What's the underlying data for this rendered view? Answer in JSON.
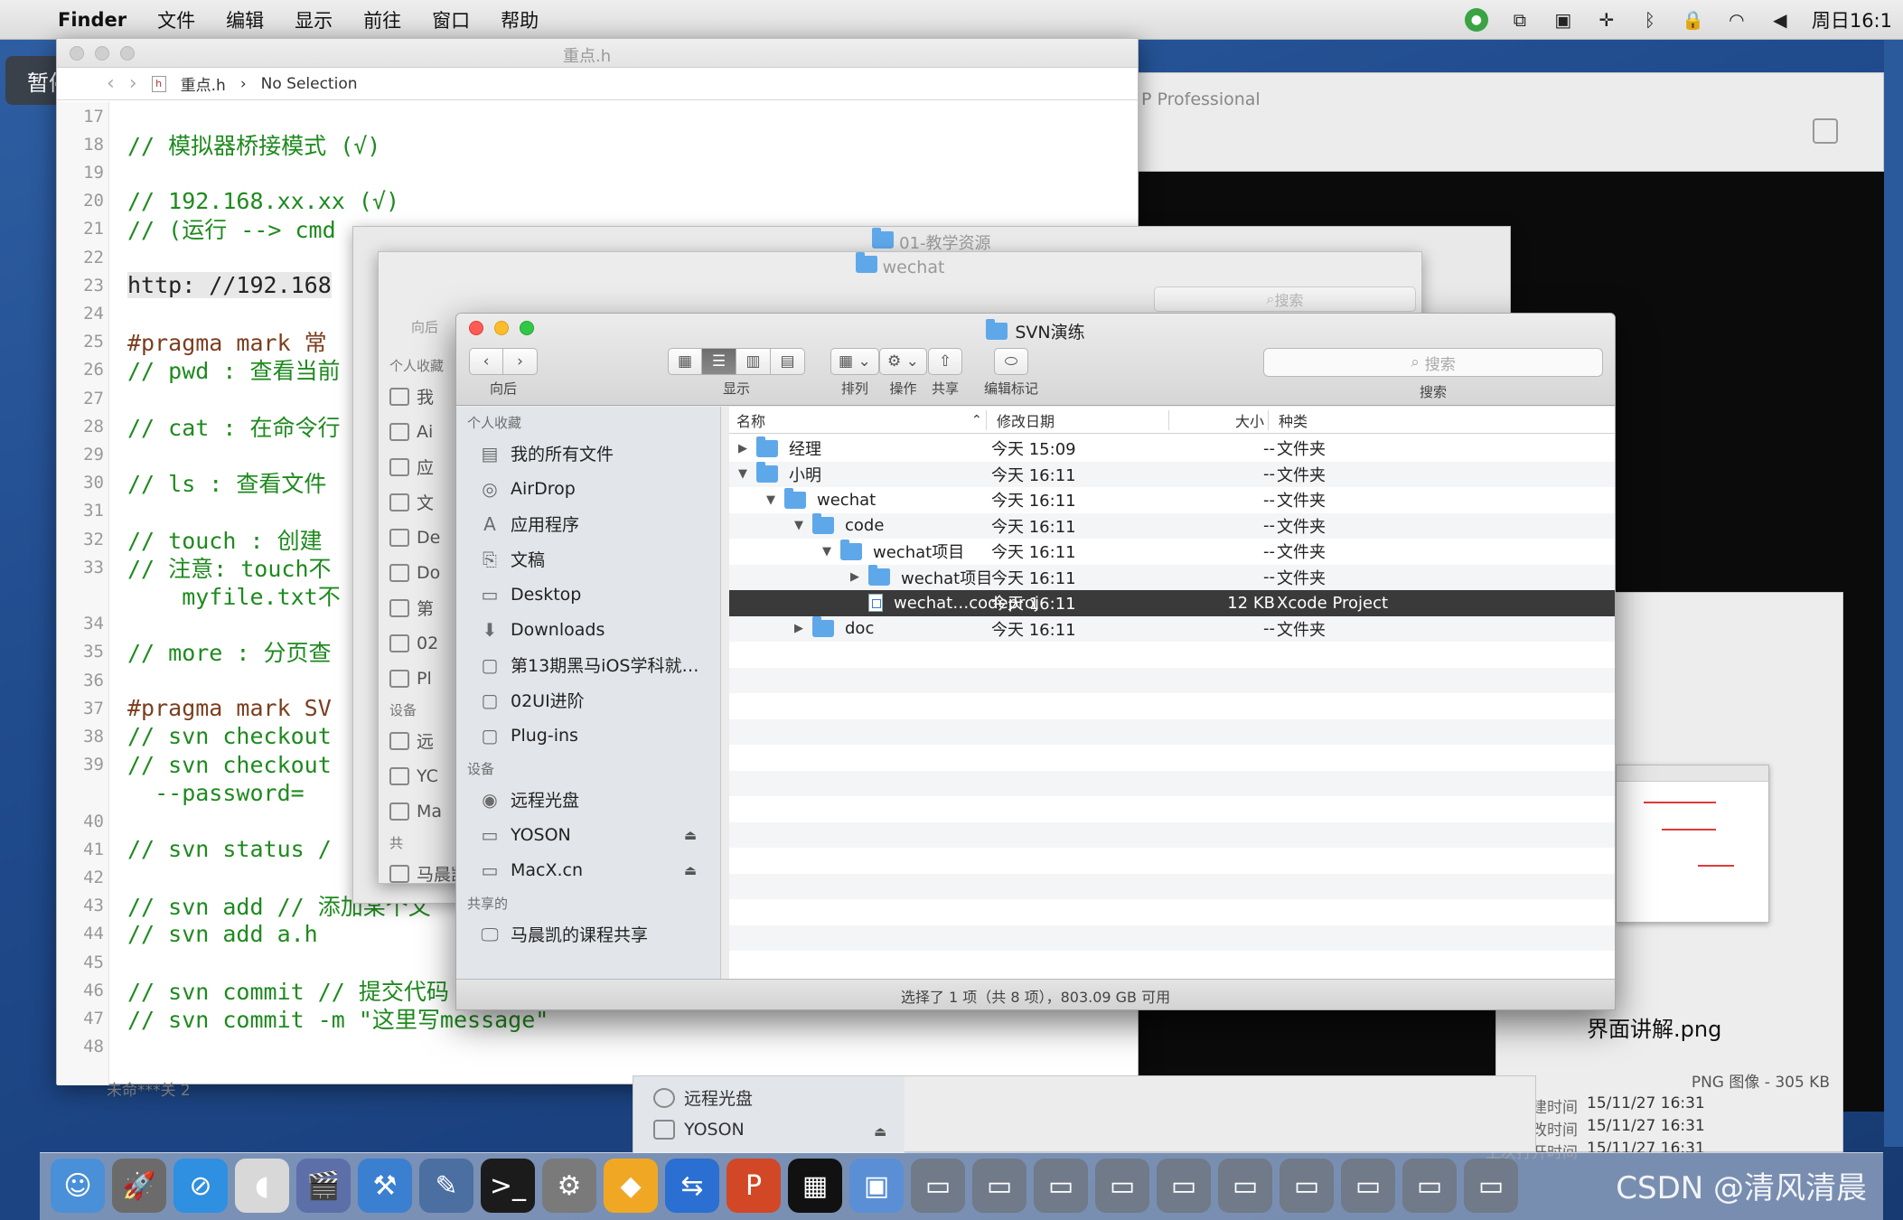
{
  "menubar": {
    "app_name": "Finder",
    "items": [
      "文件",
      "编辑",
      "显示",
      "前往",
      "窗口",
      "帮助"
    ],
    "clock": "周日16:1"
  },
  "pause_label": "暂停",
  "background": {
    "pro_window_title": "P Professional"
  },
  "xcode": {
    "title": "重点.h",
    "breadcrumb_file": "重点.h",
    "breadcrumb_sel": "No Selection",
    "lines": [
      {
        "n": "17",
        "t": "",
        "k": "c"
      },
      {
        "n": "18",
        "t": "// 模拟器桥接模式 (√)",
        "k": "c"
      },
      {
        "n": "19",
        "t": "",
        "k": "c"
      },
      {
        "n": "20",
        "t": "// 192.168.xx.xx (√)",
        "k": "c"
      },
      {
        "n": "21",
        "t": "// (运行 --> cmd",
        "k": "c"
      },
      {
        "n": "22",
        "t": "",
        "k": "c"
      },
      {
        "n": "23",
        "t": "http: //192.168",
        "k": "h"
      },
      {
        "n": "24",
        "t": "",
        "k": "c"
      },
      {
        "n": "25",
        "t": "#pragma mark 常",
        "k": "p"
      },
      {
        "n": "26",
        "t": "// pwd : 查看当前",
        "k": "c"
      },
      {
        "n": "27",
        "t": "",
        "k": "c"
      },
      {
        "n": "28",
        "t": "// cat : 在命令行",
        "k": "c"
      },
      {
        "n": "29",
        "t": "",
        "k": "c"
      },
      {
        "n": "30",
        "t": "// ls : 查看文件",
        "k": "c"
      },
      {
        "n": "31",
        "t": "",
        "k": "c"
      },
      {
        "n": "32",
        "t": "// touch : 创建",
        "k": "c"
      },
      {
        "n": "33",
        "t": "// 注意: touch不",
        "k": "c"
      },
      {
        "n": "",
        "t": "    myfile.txt不",
        "k": "c"
      },
      {
        "n": "34",
        "t": "",
        "k": "c"
      },
      {
        "n": "35",
        "t": "// more : 分页查",
        "k": "c"
      },
      {
        "n": "36",
        "t": "",
        "k": "c"
      },
      {
        "n": "37",
        "t": "#pragma mark SV",
        "k": "p"
      },
      {
        "n": "38",
        "t": "// svn checkout",
        "k": "c"
      },
      {
        "n": "39",
        "t": "// svn checkout",
        "k": "c"
      },
      {
        "n": "",
        "t": "  --password=",
        "k": "c"
      },
      {
        "n": "40",
        "t": "",
        "k": "c"
      },
      {
        "n": "41",
        "t": "// svn status /",
        "k": "c"
      },
      {
        "n": "42",
        "t": "",
        "k": "c"
      },
      {
        "n": "43",
        "t": "// svn add // 添加某个文",
        "k": "c"
      },
      {
        "n": "44",
        "t": "// svn add a.h",
        "k": "c"
      },
      {
        "n": "45",
        "t": "",
        "k": "c"
      },
      {
        "n": "46",
        "t": "// svn commit // 提交代码",
        "k": "c"
      },
      {
        "n": "47",
        "t": "// svn commit -m \"这里写message\"",
        "k": "c"
      },
      {
        "n": "48",
        "t": "",
        "k": "c"
      }
    ],
    "bottom_text": "未命***关 2"
  },
  "finder_back1": {
    "title": "01-教学资源"
  },
  "finder_back2": {
    "title": "wechat",
    "back_label": "向后",
    "search": "搜索",
    "head1": "个人收藏",
    "items": [
      "我",
      "Ai",
      "应",
      "文",
      "De",
      "Do",
      "第",
      "02",
      "Pl"
    ],
    "head2": "设备",
    "dev_items": [
      "远",
      "YC",
      "Ma"
    ],
    "head3": "共",
    "share_item": "马晨凯"
  },
  "finder": {
    "title": "SVN演练",
    "toolbar": {
      "back_label": "向后",
      "view_label": "显示",
      "arrange_label": "排列",
      "action_label": "操作",
      "share_label": "共享",
      "tags_label": "编辑标记",
      "search_placeholder": "搜索",
      "search_label": "搜索"
    },
    "sidebar": {
      "favorites_head": "个人收藏",
      "favorites": [
        {
          "label": "我的所有文件",
          "icon": "all-files-icon",
          "glyph": "▤"
        },
        {
          "label": "AirDrop",
          "icon": "airdrop-icon",
          "glyph": "◎"
        },
        {
          "label": "应用程序",
          "icon": "applications-icon",
          "glyph": "A"
        },
        {
          "label": "文稿",
          "icon": "documents-icon",
          "glyph": "⎘"
        },
        {
          "label": "Desktop",
          "icon": "desktop-icon",
          "glyph": "▭"
        },
        {
          "label": "Downloads",
          "icon": "downloads-icon",
          "glyph": "⬇"
        },
        {
          "label": "第13期黑马iOS学科就…",
          "icon": "folder-icon",
          "glyph": "▢"
        },
        {
          "label": "02UI进阶",
          "icon": "folder-icon",
          "glyph": "▢"
        },
        {
          "label": "Plug-ins",
          "icon": "folder-icon",
          "glyph": "▢"
        }
      ],
      "devices_head": "设备",
      "devices": [
        {
          "label": "远程光盘",
          "icon": "remote-disc-icon",
          "glyph": "◉",
          "eject": ""
        },
        {
          "label": "YOSON",
          "icon": "drive-icon",
          "glyph": "▭",
          "eject": "⏏"
        },
        {
          "label": "MacX.cn",
          "icon": "drive-icon",
          "glyph": "▭",
          "eject": "⏏"
        }
      ],
      "shared_head": "共享的",
      "shared": [
        {
          "label": "马晨凯的课程共享",
          "icon": "shared-computer-icon",
          "glyph": "🖵"
        }
      ]
    },
    "columns": {
      "name": "名称",
      "date": "修改日期",
      "size": "大小",
      "kind": "种类"
    },
    "rows": [
      {
        "tri": "▶",
        "depth": 0,
        "name": "经理",
        "date": "今天 15:09",
        "size": "--",
        "kind": "文件夹",
        "type": "folder"
      },
      {
        "tri": "▼",
        "depth": 0,
        "name": "小明",
        "date": "今天 16:11",
        "size": "--",
        "kind": "文件夹",
        "type": "folder"
      },
      {
        "tri": "▼",
        "depth": 1,
        "name": "wechat",
        "date": "今天 16:11",
        "size": "--",
        "kind": "文件夹",
        "type": "folder"
      },
      {
        "tri": "▼",
        "depth": 2,
        "name": "code",
        "date": "今天 16:11",
        "size": "--",
        "kind": "文件夹",
        "type": "folder"
      },
      {
        "tri": "▼",
        "depth": 3,
        "name": "wechat项目",
        "date": "今天 16:11",
        "size": "--",
        "kind": "文件夹",
        "type": "folder"
      },
      {
        "tri": "▶",
        "depth": 4,
        "name": "wechat项目",
        "date": "今天 16:11",
        "size": "--",
        "kind": "文件夹",
        "type": "folder"
      },
      {
        "tri": "",
        "depth": 4,
        "name": "wechat…codeproj",
        "date": "今天 16:11",
        "size": "12 KB",
        "kind": "Xcode Project",
        "type": "doc",
        "selected": true
      },
      {
        "tri": "▶",
        "depth": 2,
        "name": "doc",
        "date": "今天 16:11",
        "size": "--",
        "kind": "文件夹",
        "type": "folder"
      }
    ],
    "status": "选择了 1 项（共 8 项），803.09 GB 可用"
  },
  "finder_bottom": {
    "items": [
      "远程光盘",
      "YOSON"
    ]
  },
  "info": {
    "filename": "界面讲解.png",
    "kind": "PNG 图像 - 305 KB",
    "rows": [
      {
        "k": "创建时间",
        "v": "15/11/27 16:31"
      },
      {
        "k": "修改时间",
        "v": "15/11/27 16:31"
      },
      {
        "k": "上次打开时间",
        "v": "15/11/27 16:31"
      }
    ]
  },
  "dock": {
    "apps": [
      {
        "name": "finder-dock-icon",
        "glyph": "☺",
        "color": "#4a90d9"
      },
      {
        "name": "launchpad-dock-icon",
        "glyph": "🚀",
        "color": "#6b6b6b"
      },
      {
        "name": "safari-dock-icon",
        "glyph": "⊘",
        "color": "#2f8fe0"
      },
      {
        "name": "mouse-dock-icon",
        "glyph": "◖",
        "color": "#d8d8d8"
      },
      {
        "name": "imovie-dock-icon",
        "glyph": "🎬",
        "color": "#5c6fa8"
      },
      {
        "name": "xcode-dock-icon",
        "glyph": "⚒",
        "color": "#3b7fd0"
      },
      {
        "name": "instruments-dock-icon",
        "glyph": "✎",
        "color": "#4a6fa0"
      },
      {
        "name": "terminal-dock-icon",
        "glyph": ">_",
        "color": "#1b1b1b"
      },
      {
        "name": "system-prefs-dock-icon",
        "glyph": "⚙",
        "color": "#7a7a7a"
      },
      {
        "name": "sketch-dock-icon",
        "glyph": "◆",
        "color": "#f0a824"
      },
      {
        "name": "teamviewer-dock-icon",
        "glyph": "⇆",
        "color": "#2a6fd1"
      },
      {
        "name": "powerpoint-dock-icon",
        "glyph": "P",
        "color": "#d24726"
      },
      {
        "name": "activity-dock-icon",
        "glyph": "▦",
        "color": "#111111"
      },
      {
        "name": "preview-dock-icon",
        "glyph": "▣",
        "color": "#5a8fd6"
      },
      {
        "name": "window-dock-icon",
        "glyph": "▭",
        "color": "#707a88"
      },
      {
        "name": "window-dock-icon",
        "glyph": "▭",
        "color": "#707a88"
      },
      {
        "name": "window-dock-icon",
        "glyph": "▭",
        "color": "#707a88"
      },
      {
        "name": "window-dock-icon",
        "glyph": "▭",
        "color": "#707a88"
      },
      {
        "name": "window-dock-icon",
        "glyph": "▭",
        "color": "#707a88"
      },
      {
        "name": "window-dock-icon",
        "glyph": "▭",
        "color": "#707a88"
      },
      {
        "name": "window-dock-icon",
        "glyph": "▭",
        "color": "#707a88"
      },
      {
        "name": "window-dock-icon",
        "glyph": "▭",
        "color": "#707a88"
      },
      {
        "name": "window-dock-icon",
        "glyph": "▭",
        "color": "#707a88"
      },
      {
        "name": "window-dock-icon",
        "glyph": "▭",
        "color": "#707a88"
      }
    ],
    "watermark": "CSDN @清风清晨"
  },
  "colors": {
    "selection": "#3a3a3a",
    "folder": "#5ea8ea",
    "code_comment": "#1e8a1e"
  }
}
